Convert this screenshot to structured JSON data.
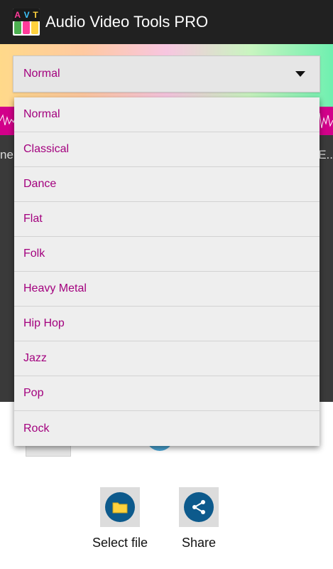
{
  "appbar": {
    "title": "Audio Video Tools PRO",
    "logo_letters": [
      "A",
      "V",
      "T"
    ],
    "logo_badge": "PRO"
  },
  "equalizer": {
    "selected": "Normal",
    "options": [
      "Normal",
      "Classical",
      "Dance",
      "Flat",
      "Folk",
      "Heavy Metal",
      "Hip Hop",
      "Jazz",
      "Pop",
      "Rock"
    ]
  },
  "background": {
    "left_text": "ne",
    "right_text": "E.."
  },
  "actions": {
    "select_file_label": "Select file",
    "share_label": "Share"
  },
  "colors": {
    "accent": "#a3007e",
    "wave": "#d2008a",
    "appbar": "#212121",
    "action_icon_bg": "#0d5a8c",
    "folder": "#ffd23e"
  },
  "icons": {
    "select_file": "folder-icon",
    "share": "share-icon",
    "dropdown": "triangle-down-icon"
  }
}
